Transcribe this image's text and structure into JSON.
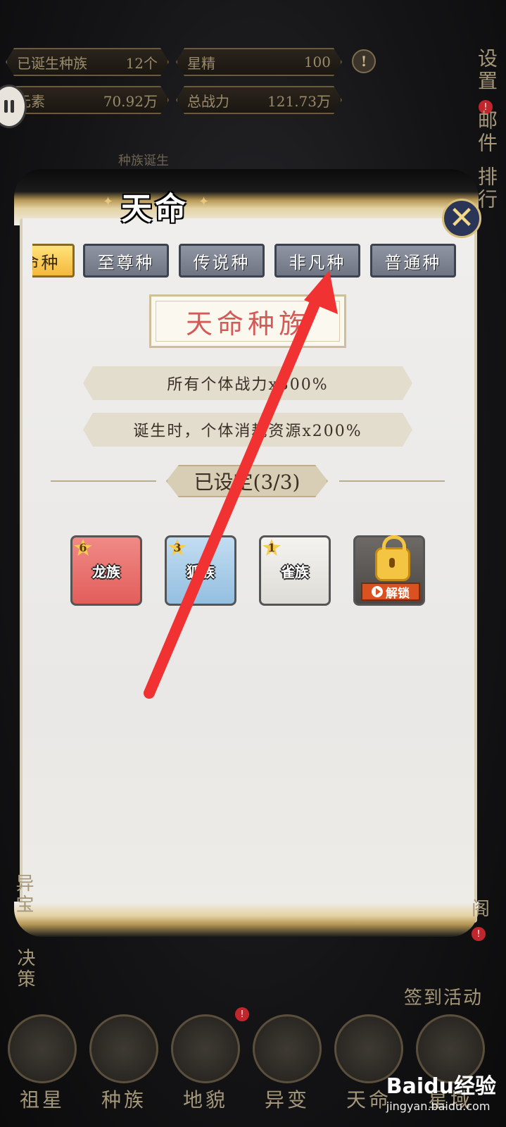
{
  "stats": {
    "born_races_label": "已诞生种族",
    "born_races_value": "12个",
    "star_essence_label": "星精",
    "star_essence_value": "100",
    "element_label": "元素",
    "element_value": "70.92万",
    "total_power_label": "总战力",
    "total_power_value": "121.73万"
  },
  "side_buttons": {
    "settings": "设置",
    "mail": "邮件",
    "rank": "排行"
  },
  "background_labels": {
    "race_birth": "种族诞生"
  },
  "modal": {
    "title": "天命",
    "tabs": [
      {
        "label": "天命种"
      },
      {
        "label": "至尊种"
      },
      {
        "label": "传说种"
      },
      {
        "label": "非凡种"
      },
      {
        "label": "普通种"
      }
    ],
    "active_tab": "天命种",
    "race_name": "天命种族",
    "effects": [
      "所有个体战力x300%",
      "诞生时，个体消耗资源x200%"
    ],
    "set_label": "已设定(3/3)",
    "cards": [
      {
        "name": "龙族",
        "level": "6",
        "color": "#ea6f6c"
      },
      {
        "name": "狐族",
        "level": "3",
        "color": "#a9cde8"
      },
      {
        "name": "雀族",
        "level": "1",
        "color": "#ebeae6"
      }
    ],
    "locked_card": {
      "unlock_label": "解锁"
    }
  },
  "left_buttons": {
    "treasure": "异宝",
    "decision": "决策"
  },
  "right_buttons": {
    "pavilion": "阁",
    "signin": "签到活动"
  },
  "bottom_nav": [
    {
      "label": "祖星"
    },
    {
      "label": "种族"
    },
    {
      "label": "地貌"
    },
    {
      "label": "异变"
    },
    {
      "label": "天命"
    },
    {
      "label": "星域"
    }
  ],
  "watermark": {
    "brand": "Baidu经验",
    "url": "jingyan.baidu.com"
  },
  "colors": {
    "arrow": "#f03232",
    "active_tab": "#f4b93c",
    "race_name": "#d35a56"
  }
}
